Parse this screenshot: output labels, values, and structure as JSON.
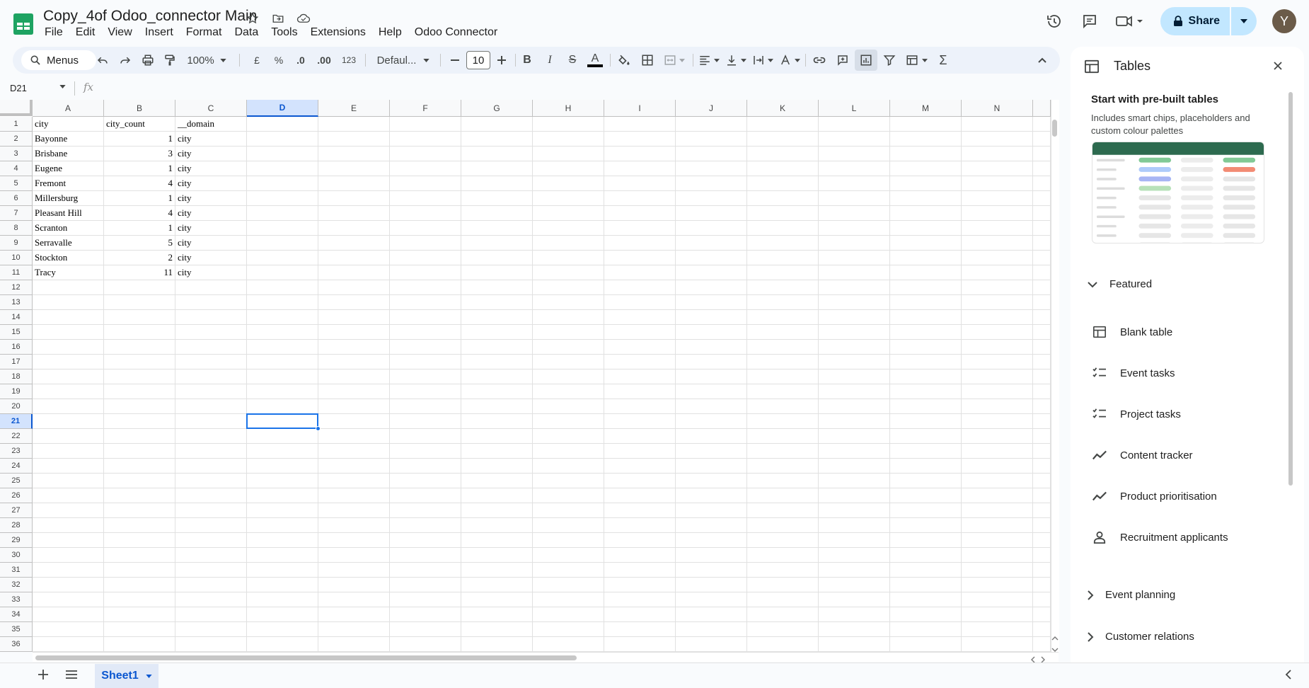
{
  "app": {
    "doc_title": "Copy_4of Odoo_connector Main",
    "menus": [
      "File",
      "Edit",
      "View",
      "Insert",
      "Format",
      "Data",
      "Tools",
      "Extensions",
      "Help",
      "Odoo Connector"
    ],
    "share_label": "Share",
    "avatar_letter": "Y"
  },
  "toolbar": {
    "menus_label": "Menus",
    "zoom": "100%",
    "currency": "£",
    "percent": "%",
    "dec_decrease": ".0",
    "dec_increase": ".00",
    "number_format": "123",
    "font": "Defaul...",
    "font_size": "10",
    "bold": "B",
    "italic": "I",
    "strike": "S",
    "text_color": "A",
    "sum": "Σ"
  },
  "formula_bar": {
    "name_box": "D21",
    "fx": "fx",
    "value": ""
  },
  "grid": {
    "columns": [
      "A",
      "B",
      "C",
      "D",
      "E",
      "F",
      "G",
      "H",
      "I",
      "J",
      "K",
      "L",
      "M",
      "N"
    ],
    "selected_column": "D",
    "selected_row": 21,
    "row_count": 36,
    "rows": [
      [
        "city",
        "city_count",
        "__domain"
      ],
      [
        "Bayonne",
        "1",
        "city"
      ],
      [
        "Brisbane",
        "3",
        "city"
      ],
      [
        "Eugene",
        "1",
        "city"
      ],
      [
        "Fremont",
        "4",
        "city"
      ],
      [
        "Millersburg",
        "1",
        "city"
      ],
      [
        "Pleasant Hill",
        "4",
        "city"
      ],
      [
        "Scranton",
        "1",
        "city"
      ],
      [
        "Serravalle",
        "5",
        "city"
      ],
      [
        "Stockton",
        "2",
        "city"
      ],
      [
        "Tracy",
        "11",
        "city"
      ]
    ]
  },
  "sheets": {
    "active": "Sheet1"
  },
  "panel": {
    "title": "Tables",
    "heading": "Start with pre-built tables",
    "description": "Includes smart chips, placeholders and custom colour palettes",
    "featured_label": "Featured",
    "templates": [
      {
        "label": "Blank table",
        "icon": "table-icon"
      },
      {
        "label": "Event tasks",
        "icon": "checklist-icon"
      },
      {
        "label": "Project tasks",
        "icon": "checklist-icon"
      },
      {
        "label": "Content tracker",
        "icon": "trend-icon"
      },
      {
        "label": "Product prioritisation",
        "icon": "trend-icon"
      },
      {
        "label": "Recruitment applicants",
        "icon": "person-icon"
      }
    ],
    "sections": [
      "Event planning",
      "Customer relations"
    ],
    "preview_colors": {
      "header": "#2d6a4f",
      "chips": [
        "#81c995",
        "#aecbfa",
        "#a7b5f4",
        "#b7e1b9",
        "#f28b74"
      ]
    }
  }
}
